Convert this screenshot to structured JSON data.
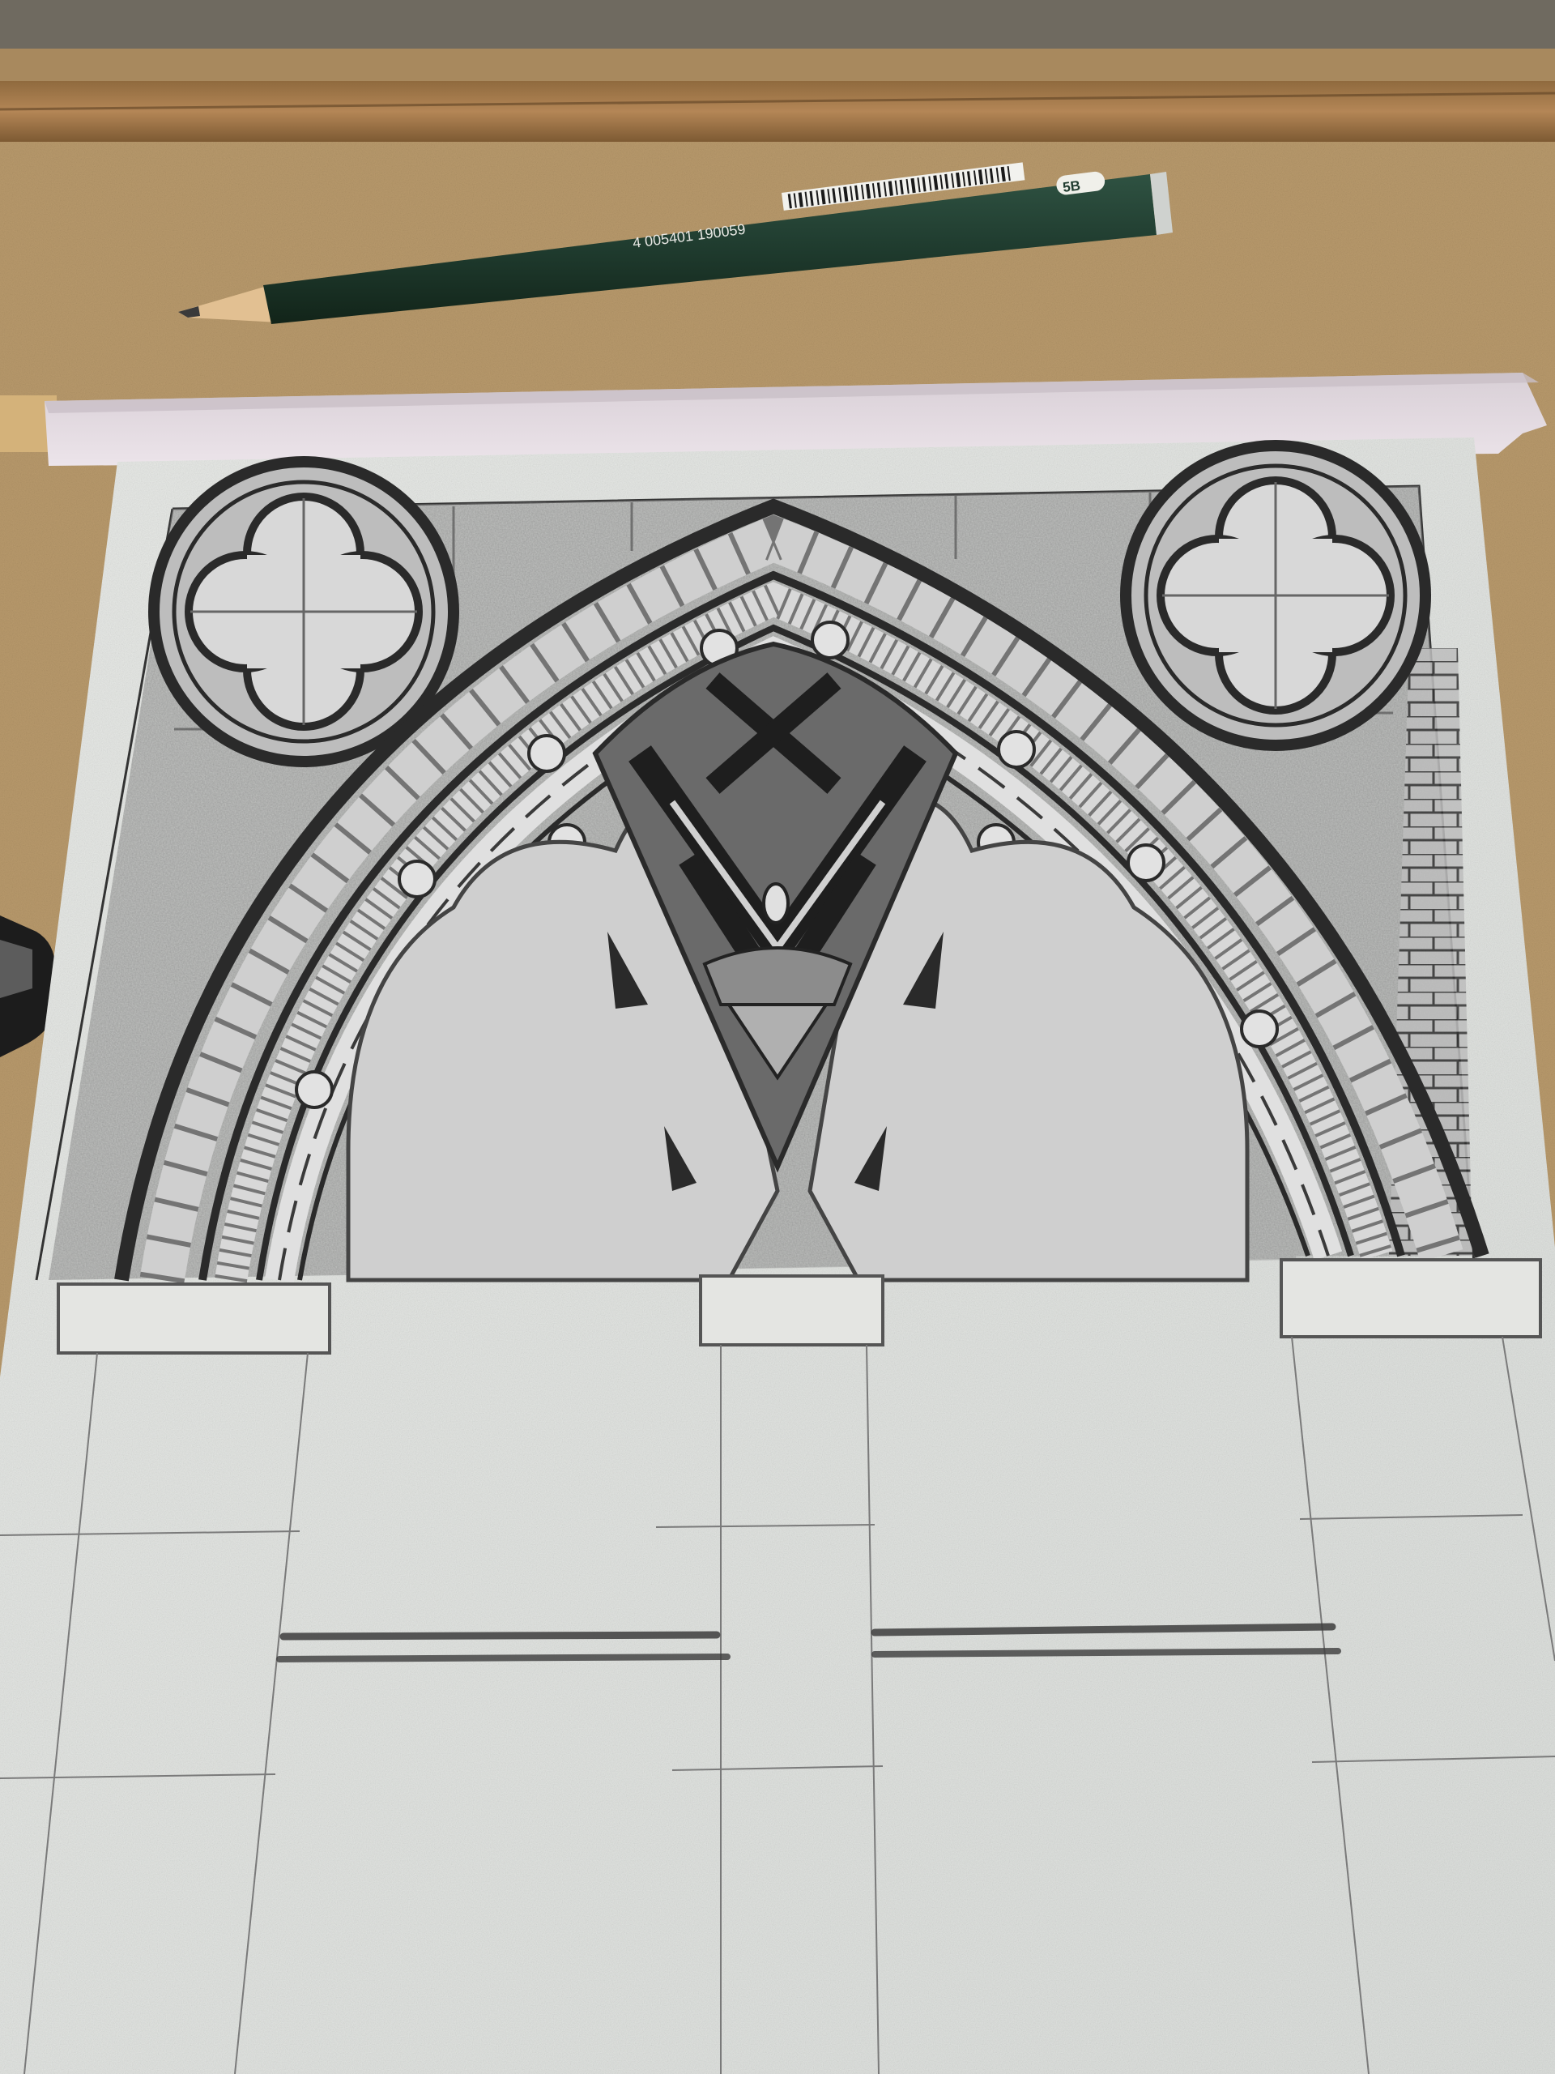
{
  "pencil": {
    "grade": "5B",
    "barcode_number": "4 005401 190059"
  },
  "colors": {
    "desk": "#b89a6e",
    "board_frame": "#a07b4d",
    "pencil_body": "#1f3b2e",
    "tape": "#e6dde3",
    "paper": "#e4e6e3",
    "graphite": "#3a3a3a"
  }
}
